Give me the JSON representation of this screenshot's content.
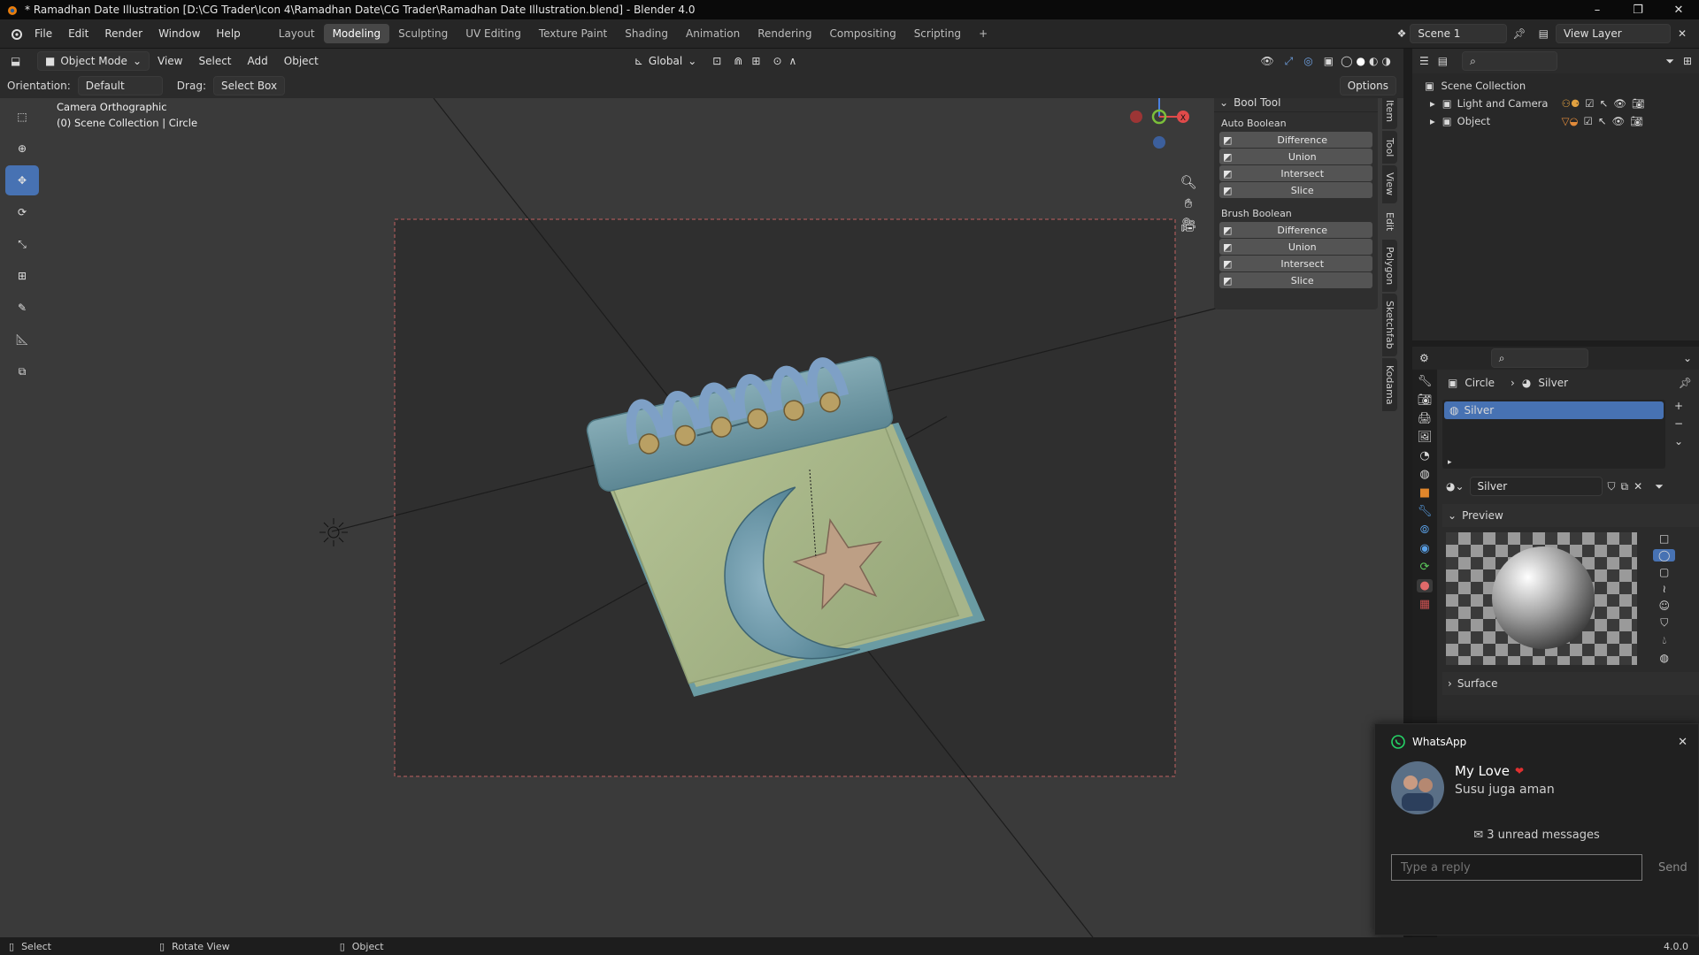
{
  "window": {
    "title": "* Ramadhan Date Illustration [D:\\CG Trader\\Icon 4\\Ramadhan Date\\CG Trader\\Ramadhan Date Illustration.blend] - Blender 4.0",
    "controls": [
      "–",
      "❐",
      "✕"
    ]
  },
  "menu": [
    "File",
    "Edit",
    "Render",
    "Window",
    "Help"
  ],
  "workspaces": [
    "Layout",
    "Modeling",
    "Sculpting",
    "UV Editing",
    "Texture Paint",
    "Shading",
    "Animation",
    "Rendering",
    "Compositing",
    "Scripting",
    "+"
  ],
  "active_workspace": "Modeling",
  "scene": {
    "name": "Scene 1",
    "view_layer": "View Layer"
  },
  "header": {
    "mode": "Object Mode",
    "menus": [
      "View",
      "Select",
      "Add",
      "Object"
    ],
    "transform_orientation": "Global",
    "options_label": "Options"
  },
  "tool_settings": {
    "orientation_label": "Orientation:",
    "orientation_value": "Default",
    "drag_label": "Drag:",
    "drag_value": "Select Box"
  },
  "viewport": {
    "view_name": "Camera Orthographic",
    "collection_info": "(0) Scene Collection | Circle",
    "gizmo_axes": {
      "z": "Z",
      "x": "X"
    }
  },
  "bool_tool": {
    "title": "Bool Tool",
    "auto_heading": "Auto Boolean",
    "auto_buttons": [
      "Difference",
      "Union",
      "Intersect",
      "Slice"
    ],
    "brush_heading": "Brush Boolean",
    "brush_buttons": [
      "Difference",
      "Union",
      "Intersect",
      "Slice"
    ]
  },
  "sidebar_tabs": [
    "Item",
    "Tool",
    "View",
    "Edit",
    "Polygon",
    "Sketchfab",
    "Kodama"
  ],
  "outliner": {
    "root": "Scene Collection",
    "children": [
      "Light and Camera",
      "Object"
    ]
  },
  "properties": {
    "breadcrumb_object": "Circle",
    "breadcrumb_material": "Silver",
    "slot_name": "Silver",
    "material_name": "Silver",
    "preview_label": "Preview",
    "surface_label": "Surface"
  },
  "notification": {
    "app": "WhatsApp",
    "sender": "My Love",
    "message": "Susu juga aman",
    "unread": "3 unread messages",
    "reply_placeholder": "Type a reply",
    "send_label": "Send",
    "close": "✕"
  },
  "status": {
    "items": [
      "Select",
      "Rotate View",
      "Object"
    ],
    "version": "4.0.0"
  },
  "colors": {
    "accent": "#4772b3",
    "calendar_top": "#6f98a4",
    "calendar_page": "#a9b889",
    "star": "#b99b82",
    "ring": "#7e9fc5"
  }
}
